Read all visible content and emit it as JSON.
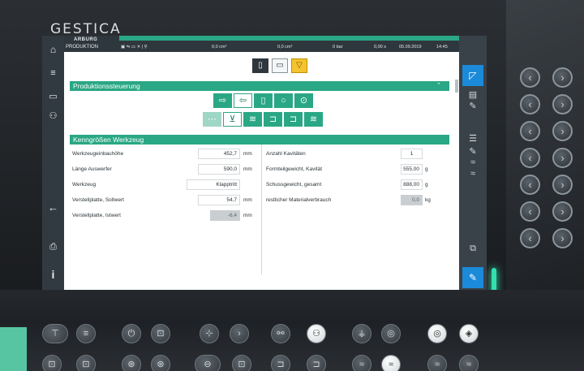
{
  "brand": "GESTICA",
  "topbar": {
    "logo": "ARBURG",
    "mode": "PRODUKTION",
    "readouts": [
      "0,0 cm³",
      "0,0 cm³",
      "0 bar",
      "0,00 s"
    ],
    "date": "05.09.2019",
    "time": "14:45"
  },
  "sections": {
    "production": {
      "title": "Produktionssteuerung",
      "chevron": "⌃"
    },
    "tool": {
      "title": "Kenngrößen Werkzeug"
    }
  },
  "tool_params_left": [
    {
      "label": "Werkzeugeinbauhöhe",
      "value": "452,7",
      "unit": "mm",
      "readonly": false
    },
    {
      "label": "Länge Auswerfer",
      "value": "590,0",
      "unit": "mm",
      "readonly": false
    },
    {
      "label": "Werkzeug",
      "value": "Klapptritt",
      "unit": "",
      "readonly": false
    },
    {
      "label": "Verstellplatte, Sollwert",
      "value": "54,7",
      "unit": "mm",
      "readonly": false
    },
    {
      "label": "Verstellplatte, Istwert",
      "value": "-6,4",
      "unit": "mm",
      "readonly": true
    }
  ],
  "tool_params_right": [
    {
      "label": "Anzahl Kavitäten",
      "value": "1",
      "unit": "",
      "readonly": false
    },
    {
      "label": "Formteilgewicht, Kavität",
      "value": "555,00",
      "unit": "g",
      "readonly": false
    },
    {
      "label": "Schussgewicht, gesamt",
      "value": "888,00",
      "unit": "g",
      "readonly": false
    },
    {
      "label": "restlicher Materialverbrauch",
      "value": "0,0",
      "unit": "kg",
      "readonly": true
    }
  ],
  "icons": {
    "home": "⌂",
    "back": "←",
    "info": "i"
  },
  "colors": {
    "accent": "#2aa784",
    "active_blue": "#1b8ad9",
    "warning": "#f4c430",
    "glow": "#38ffc5"
  }
}
